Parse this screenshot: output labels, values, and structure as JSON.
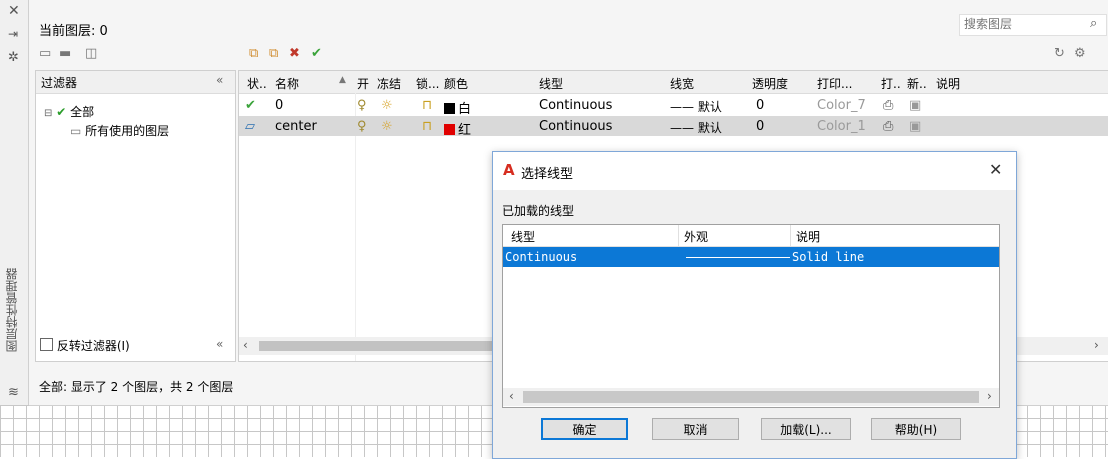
{
  "palette": {
    "current_layer": "当前图层: 0",
    "search_placeholder": "搜索图层",
    "side_title": "图层特性管理器",
    "status": "全部: 显示了 2 个图层，共 2 个图层",
    "filter_header": "过滤器",
    "filter_collapse": "«",
    "tree": {
      "root": "全部",
      "child": "所有使用的图层"
    },
    "invert_filter_label": "反转过滤器(I)"
  },
  "table": {
    "columns": [
      "状..",
      "名称",
      "开",
      "冻结",
      "锁...",
      "颜色",
      "线型",
      "线宽",
      "透明度",
      "打印...",
      "打..",
      "新..",
      "说明"
    ],
    "rows": [
      {
        "name": "0",
        "color_name": "白",
        "color_hex": "#000000",
        "linetype": "Continuous",
        "lineweight": "—— 默认",
        "transparency": "0",
        "plot_style": "Color_7"
      },
      {
        "name": "center",
        "color_name": "红",
        "color_hex": "#e00000",
        "linetype": "Continuous",
        "lineweight": "—— 默认",
        "transparency": "0",
        "plot_style": "Color_1"
      }
    ]
  },
  "dialog": {
    "title": "选择线型",
    "section_label": "已加载的线型",
    "columns": [
      "线型",
      "外观",
      "说明"
    ],
    "rows": [
      {
        "linetype": "Continuous",
        "description": "Solid line"
      }
    ],
    "buttons": {
      "ok": "确定",
      "cancel": "取消",
      "load": "加载(L)...",
      "help": "帮助(H)"
    }
  },
  "colors": {
    "selection": "#0c78d6",
    "autocad_red": "#d62d20"
  }
}
